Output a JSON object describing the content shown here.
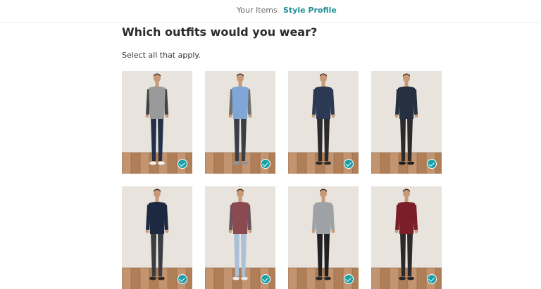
{
  "nav": {
    "your_items": "Your Items",
    "style_profile": "Style Profile"
  },
  "quiz": {
    "question": "Which outfits would you wear?",
    "instruction": "Select all that apply."
  },
  "outfits": [
    {
      "id": "outfit-1",
      "selected": false,
      "top_color": "#9a9a9a",
      "sleeve_color": "#3f4143",
      "pants_color": "#22304a",
      "shoe_color": "#f2f2f2"
    },
    {
      "id": "outfit-2",
      "selected": false,
      "top_color": "#7fa6d6",
      "sleeve_color": "#6d7170",
      "pants_color": "#3b3f45",
      "shoe_color": "#8f9399"
    },
    {
      "id": "outfit-3",
      "selected": false,
      "top_color": "#2b3952",
      "sleeve_color": "#2b3952",
      "pants_color": "#2a2a2c",
      "shoe_color": "#2a2a2a"
    },
    {
      "id": "outfit-4",
      "selected": true,
      "top_color": "#263040",
      "sleeve_color": "#263040",
      "pants_color": "#2b2b2d",
      "shoe_color": "#1d1d1d"
    },
    {
      "id": "outfit-5",
      "selected": false,
      "top_color": "#1c2940",
      "sleeve_color": "#1c2940",
      "pants_color": "#3a3d42",
      "shoe_color": "#3a2b22"
    },
    {
      "id": "outfit-6",
      "selected": false,
      "top_color": "#8b4a4f",
      "sleeve_color": "#6a5560",
      "pants_color": "#a9c0d6",
      "shoe_color": "#e8e8e8"
    },
    {
      "id": "outfit-7",
      "selected": false,
      "top_color": "#9ea2a6",
      "sleeve_color": "#9ea2a6",
      "pants_color": "#1f2023",
      "shoe_color": "#2a2a2a"
    },
    {
      "id": "outfit-8",
      "selected": false,
      "top_color": "#7a1f29",
      "sleeve_color": "#7a1f29",
      "pants_color": "#2a2a2d",
      "shoe_color": "#2a2a2a"
    }
  ],
  "colors": {
    "accent": "#1d8f97",
    "check": "#1aa0a8",
    "selected_border": "#31b3b8",
    "wall": "#e8e3dc",
    "floor": "#b98a62",
    "skin": "#c89a7a"
  }
}
